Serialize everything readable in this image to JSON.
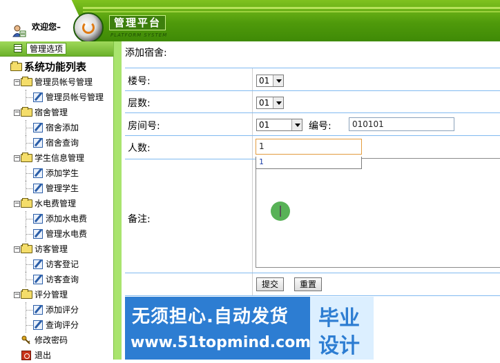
{
  "header": {
    "welcome": "欢迎您–",
    "brand_cn": "管理平台",
    "brand_en": "PLATFORM SYSTEM"
  },
  "sidebar": {
    "header_label": "管理选项",
    "root_label": "系统功能列表",
    "groups": [
      {
        "label": "管理员帐号管理",
        "items": [
          "管理员帐号管理"
        ]
      },
      {
        "label": "宿舍管理",
        "items": [
          "宿舍添加",
          "宿舍查询"
        ]
      },
      {
        "label": "学生信息管理",
        "items": [
          "添加学生",
          "管理学生"
        ]
      },
      {
        "label": "水电费管理",
        "items": [
          "添加水电费",
          "管理水电费"
        ]
      },
      {
        "label": "访客管理",
        "items": [
          "访客登记",
          "访客查询"
        ]
      },
      {
        "label": "评分管理",
        "items": [
          "添加评分",
          "查询评分"
        ]
      }
    ],
    "change_password": "修改密码",
    "logout": "退出"
  },
  "form": {
    "page_title": "添加宿舍:",
    "building_label": "楼号:",
    "building_value": "01",
    "floor_label": "层数:",
    "floor_value": "01",
    "room_label": "房间号:",
    "room_value": "01",
    "code_label": "编号:",
    "code_value": "010101",
    "people_label": "人数:",
    "people_value": "1",
    "people_suggestion": "1",
    "remark_label": "备注:",
    "submit_label": "提交",
    "reset_label": "重置"
  },
  "watermark": {
    "line1": "无须担心.自动发货",
    "line2": "www.51topmind.com",
    "badge1": "毕业",
    "badge2": "设计"
  }
}
